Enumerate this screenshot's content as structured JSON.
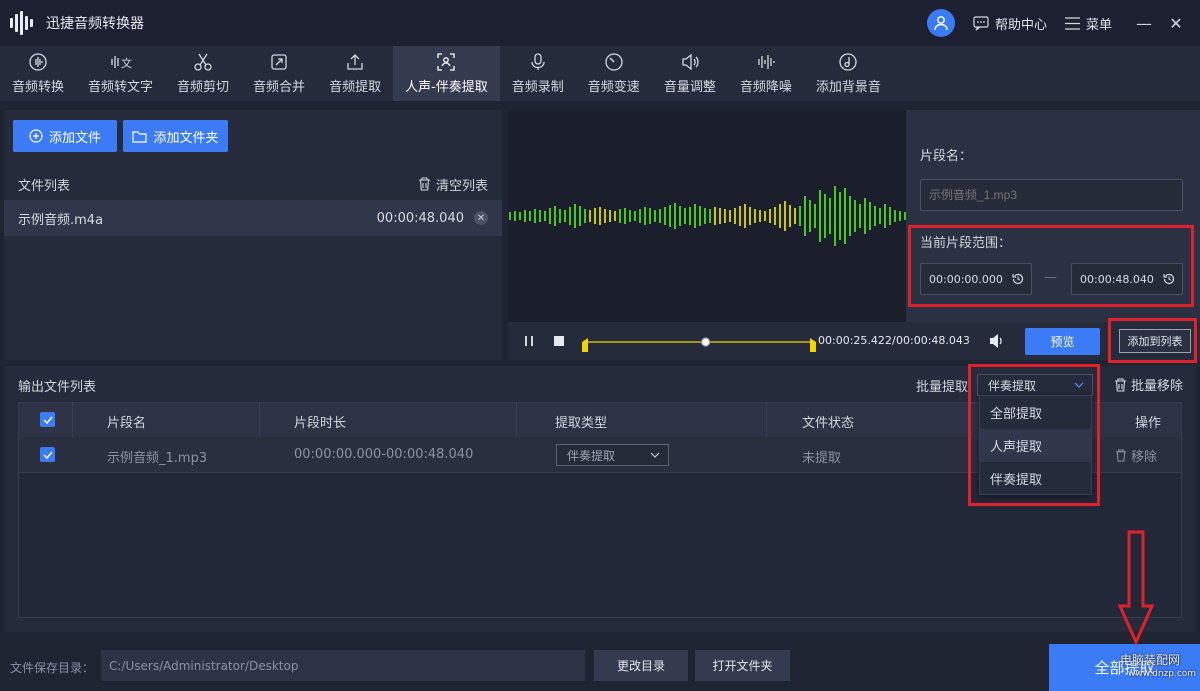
{
  "app": {
    "title": "迅捷音频转换器"
  },
  "titlebar": {
    "help": "帮助中心",
    "menu": "菜单",
    "minimize": "—",
    "close": "✕"
  },
  "tabs": [
    {
      "label": "音频转换",
      "icon": "audio-convert-icon"
    },
    {
      "label": "音频转文字",
      "icon": "audio-to-text-icon"
    },
    {
      "label": "音频剪切",
      "icon": "scissors-icon"
    },
    {
      "label": "音频合并",
      "icon": "merge-icon"
    },
    {
      "label": "音频提取",
      "icon": "extract-icon"
    },
    {
      "label": "人声-伴奏提取",
      "icon": "vocal-extract-icon",
      "active": true
    },
    {
      "label": "音频录制",
      "icon": "microphone-icon"
    },
    {
      "label": "音频变速",
      "icon": "speed-icon"
    },
    {
      "label": "音量调整",
      "icon": "volume-icon"
    },
    {
      "label": "音频降噪",
      "icon": "denoise-icon"
    },
    {
      "label": "添加背景音",
      "icon": "background-music-icon"
    }
  ],
  "left": {
    "add_file": "添加文件",
    "add_folder": "添加文件夹",
    "file_list_title": "文件列表",
    "clear_list": "清空列表",
    "file": {
      "name": "示例音频.m4a",
      "duration": "00:00:48.040"
    }
  },
  "segment": {
    "name_label": "片段名：",
    "name_placeholder": "示例音频_1.mp3",
    "range_label": "当前片段范围：",
    "start": "00:00:00.000",
    "sep": "—",
    "end": "00:00:48.040"
  },
  "player": {
    "current": "00:00:25.422",
    "slash": "/",
    "total": "00:00:48.043",
    "position": 0.53,
    "preview": "预览",
    "add_to_list": "添加到列表"
  },
  "output": {
    "title": "输出文件列表",
    "batch_label": "批量提取",
    "batch_value": "伴奏提取",
    "batch_remove": "批量移除",
    "columns": [
      "片段名",
      "片段时长",
      "提取类型",
      "文件状态",
      "操作"
    ],
    "rows": [
      {
        "name": "示例音频_1.mp3",
        "duration": "00:00:00.000-00:00:48.040",
        "type": "伴奏提取",
        "status": "未提取",
        "action": "移除"
      }
    ],
    "dropdown": [
      "全部提取",
      "人声提取",
      "伴奏提取"
    ]
  },
  "bottom": {
    "save_label": "文件保存目录：",
    "path": "C:/Users/Administrator/Desktop",
    "change_dir": "更改目录",
    "open_folder": "打开文件夹",
    "convert_all": "全部提取"
  },
  "watermark": {
    "line1": "电脑装配网",
    "line2": "www.dnzp.com"
  },
  "colors": {
    "accent": "#3b7bf6",
    "highlight_red": "#e0202a",
    "wave_green": "#4cc627",
    "wave_yellow": "#c9c51e"
  }
}
